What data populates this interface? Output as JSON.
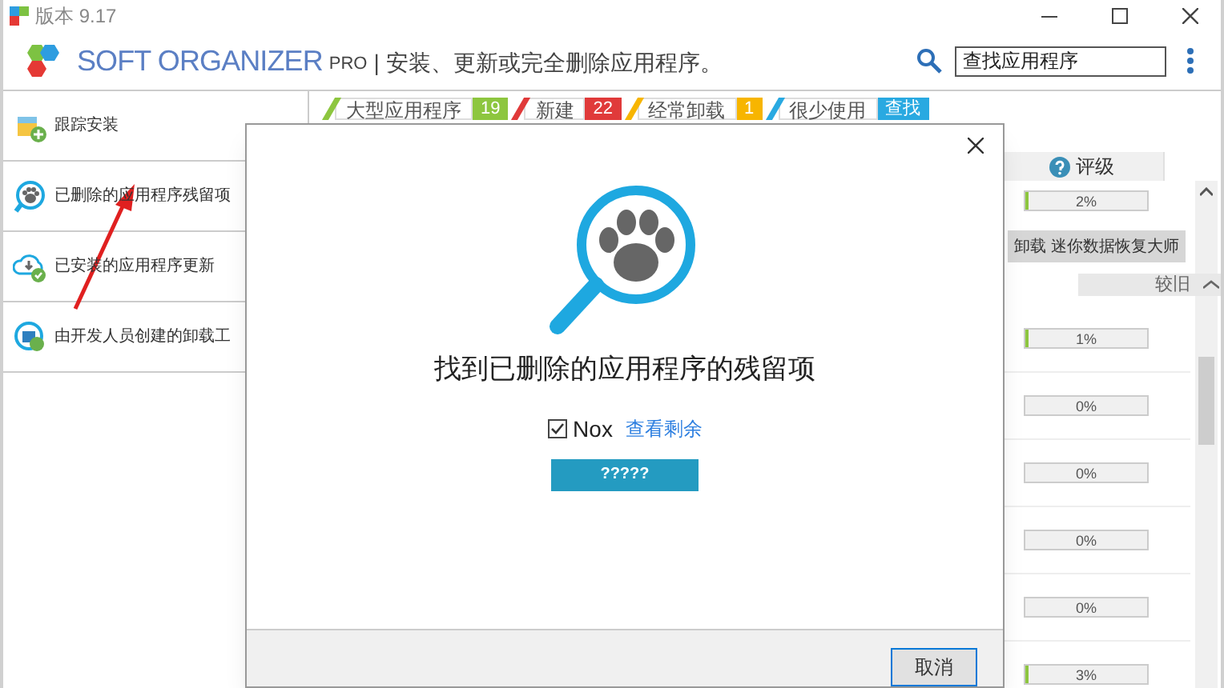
{
  "window": {
    "title": "版本 9.17"
  },
  "header": {
    "brand": "SOFT ORGANIZER",
    "edition": "PRO",
    "tagline": "| 安装、更新或完全删除应用程序。",
    "search": {
      "placeholder": "查找应用程序"
    }
  },
  "sidebar": {
    "items": [
      {
        "label": "跟踪安装"
      },
      {
        "label": "已删除的应用程序残留项"
      },
      {
        "label": "已安装的应用程序更新"
      },
      {
        "label": "由开发人员创建的卸载工"
      }
    ]
  },
  "filters": [
    {
      "label": "大型应用程序",
      "count": "19",
      "color": "#8dc63f"
    },
    {
      "label": "新建",
      "count": "22",
      "color": "#e03a3a"
    },
    {
      "label": "经常卸载",
      "count": "1",
      "color": "#f7b500"
    },
    {
      "label": "很少使用",
      "count": "查找",
      "color": "#29a9e1"
    }
  ],
  "table": {
    "rating_header": "评级",
    "rows": [
      {
        "kind": "bar",
        "reading": "2%",
        "level": 0.02
      },
      {
        "kind": "action",
        "label": "卸载 迷你数据恢复大师"
      },
      {
        "kind": "group",
        "label": "较旧"
      },
      {
        "kind": "bar",
        "reading": "1%",
        "level": 0.01
      },
      {
        "kind": "bar",
        "reading": "0%",
        "level": 0
      },
      {
        "kind": "bar",
        "reading": "0%",
        "level": 0
      },
      {
        "kind": "bar",
        "reading": "0%",
        "level": 0
      },
      {
        "kind": "bar",
        "reading": "0%",
        "level": 0
      },
      {
        "kind": "bar",
        "reading": "3%",
        "level": 0.03
      }
    ]
  },
  "dialog": {
    "heading": "找到已删除的应用程序的残留项",
    "item": {
      "label": "Nox",
      "checked": true,
      "link": "查看剩余"
    },
    "primary_button": "?????",
    "cancel_button": "取消"
  }
}
